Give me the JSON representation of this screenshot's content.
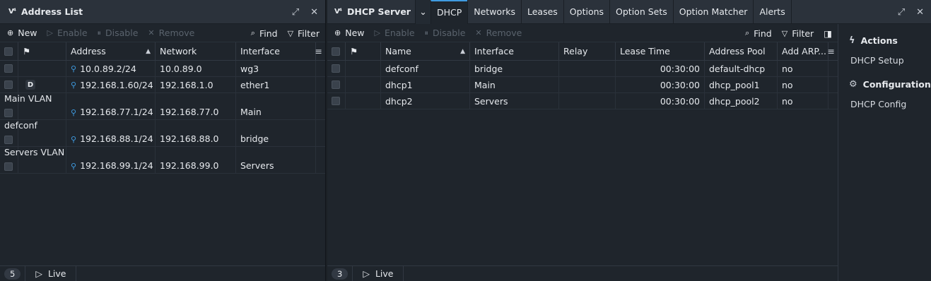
{
  "logo": "V⁴",
  "left": {
    "title": "Address List",
    "icons": {
      "popout": "popout-icon",
      "close": "close-icon"
    },
    "toolbar": {
      "new": "New",
      "enable": "Enable",
      "disable": "Disable",
      "remove": "Remove",
      "find": "Find",
      "filter": "Filter"
    },
    "columns": {
      "address": "Address",
      "network": "Network",
      "interface": "Interface"
    },
    "rows": [
      {
        "flag": "",
        "address": "10.0.89.2/24",
        "network": "10.0.89.0",
        "interface": "wg3"
      },
      {
        "flag": "D",
        "address": "192.168.1.60/24",
        "network": "192.168.1.0",
        "interface": "ether1"
      },
      {
        "group": "Main VLAN",
        "flag": "",
        "address": "192.168.77.1/24",
        "network": "192.168.77.0",
        "interface": "Main"
      },
      {
        "group": "defconf",
        "flag": "",
        "address": "192.168.88.1/24",
        "network": "192.168.88.0",
        "interface": "bridge"
      },
      {
        "group": "Servers VLAN",
        "flag": "",
        "address": "192.168.99.1/24",
        "network": "192.168.99.0",
        "interface": "Servers"
      }
    ],
    "footer": {
      "count": "5",
      "live": "Live"
    }
  },
  "right": {
    "title": "DHCP Server",
    "tabs": [
      "DHCP",
      "Networks",
      "Leases",
      "Options",
      "Option Sets",
      "Option Matcher",
      "Alerts"
    ],
    "active_tab": "DHCP",
    "toolbar": {
      "new": "New",
      "enable": "Enable",
      "disable": "Disable",
      "remove": "Remove",
      "find": "Find",
      "filter": "Filter"
    },
    "columns": {
      "name": "Name",
      "interface": "Interface",
      "relay": "Relay",
      "lease_time": "Lease Time",
      "address_pool": "Address Pool",
      "add_arp": "Add ARP..."
    },
    "rows": [
      {
        "name": "defconf",
        "interface": "bridge",
        "relay": "",
        "lease_time": "00:30:00",
        "address_pool": "default-dhcp",
        "add_arp": "no"
      },
      {
        "name": "dhcp1",
        "interface": "Main",
        "relay": "",
        "lease_time": "00:30:00",
        "address_pool": "dhcp_pool1",
        "add_arp": "no"
      },
      {
        "name": "dhcp2",
        "interface": "Servers",
        "relay": "",
        "lease_time": "00:30:00",
        "address_pool": "dhcp_pool2",
        "add_arp": "no"
      }
    ],
    "footer": {
      "count": "3",
      "live": "Live"
    },
    "sidebar": {
      "actions_title": "Actions",
      "actions_item": "DHCP Setup",
      "config_title": "Configuration",
      "config_item": "DHCP Config"
    }
  },
  "colors": {
    "accent": "#3f9be0",
    "background": "#1f252c",
    "titlebar": "#2b323b"
  }
}
